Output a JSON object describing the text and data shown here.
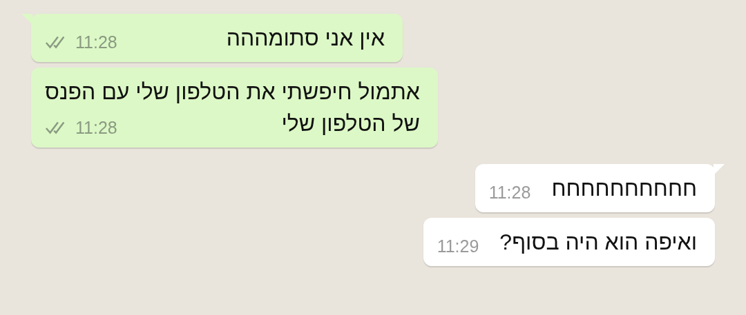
{
  "messages": [
    {
      "kind": "outgoing",
      "lines": [
        "אין אני סתומההה"
      ],
      "time": "11:28",
      "delivered": true,
      "tail": true
    },
    {
      "kind": "outgoing",
      "lines": [
        "אתמול חיפשתי את הטלפון שלי עם הפנס",
        "של הטלפון שלי"
      ],
      "time": "11:28",
      "delivered": true,
      "tail": false
    },
    {
      "kind": "incoming",
      "lines": [
        "חחחחחחחחחח"
      ],
      "time": "11:28",
      "tail": true
    },
    {
      "kind": "incoming",
      "lines": [
        "ואיפה הוא היה בסוף?"
      ],
      "time": "11:29",
      "tail": false
    }
  ]
}
